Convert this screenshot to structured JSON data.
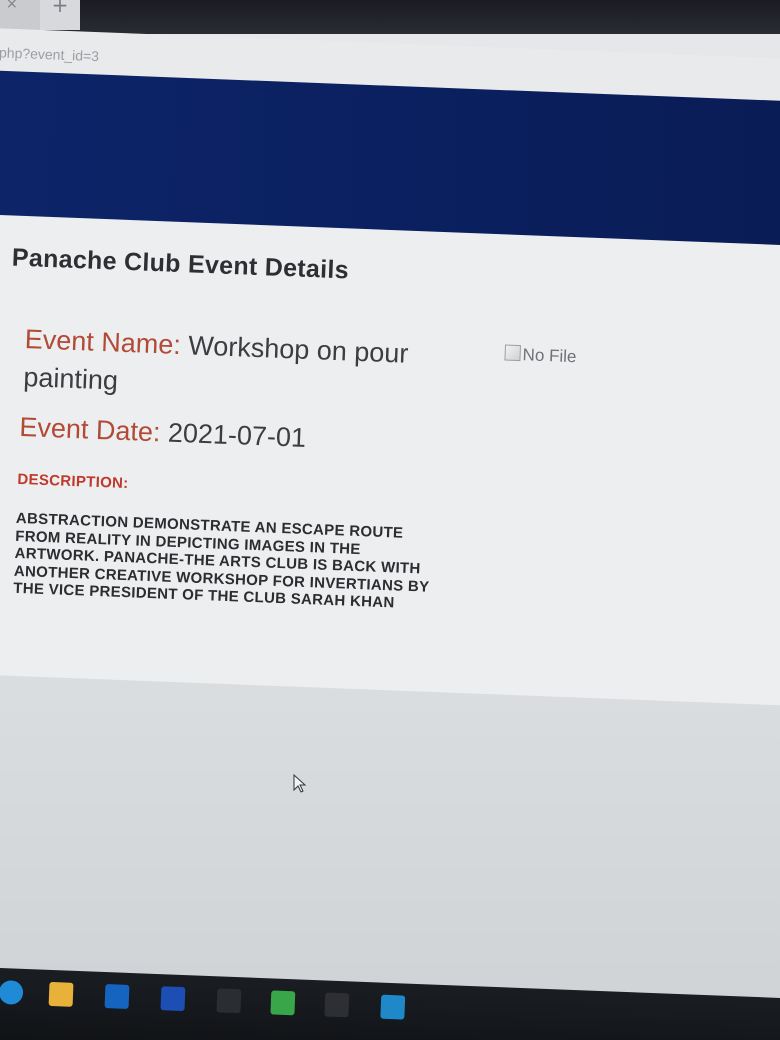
{
  "browser": {
    "tab": {
      "close_glyph": "×",
      "new_tab_glyph": "+"
    },
    "address": {
      "url_text": "php?event_id=3"
    }
  },
  "page": {
    "title": "Panache Club Event Details",
    "event_name": {
      "label": "Event Name:",
      "value": "Workshop on pour painting"
    },
    "event_date": {
      "label": "Event Date:",
      "value": "2021-07-01"
    },
    "description": {
      "label": "DESCRIPTION:",
      "text": "ABSTRACTION DEMONSTRATE AN ESCAPE ROUTE FROM REALITY IN DEPICTING IMAGES IN THE ARTWORK. PANACHE-THE ARTS CLUB IS BACK WITH ANOTHER CREATIVE WORKSHOP FOR INVERTIANS BY THE VICE PRESIDENT OF THE CLUB SARAH KHAN"
    },
    "image_alt": "No File"
  },
  "colors": {
    "header_band": "#0d2569",
    "label_color": "#b24a36",
    "description_label_color": "#c0392b"
  },
  "taskbar": {
    "icons": [
      {
        "name": "edge-icon",
        "color": "#1f8ad6"
      },
      {
        "name": "file-explorer-icon",
        "color": "#e8b23a"
      },
      {
        "name": "mail-icon",
        "color": "#1565c0"
      },
      {
        "name": "tile-app-icon",
        "color": "#1d4eb3"
      },
      {
        "name": "xbox-icon",
        "color": "#2a2d31"
      },
      {
        "name": "green-app-icon",
        "color": "#3aa64a"
      },
      {
        "name": "store-icon",
        "color": "#2d2f34"
      },
      {
        "name": "whatsapp-icon",
        "color": "#1e88c9"
      }
    ]
  }
}
